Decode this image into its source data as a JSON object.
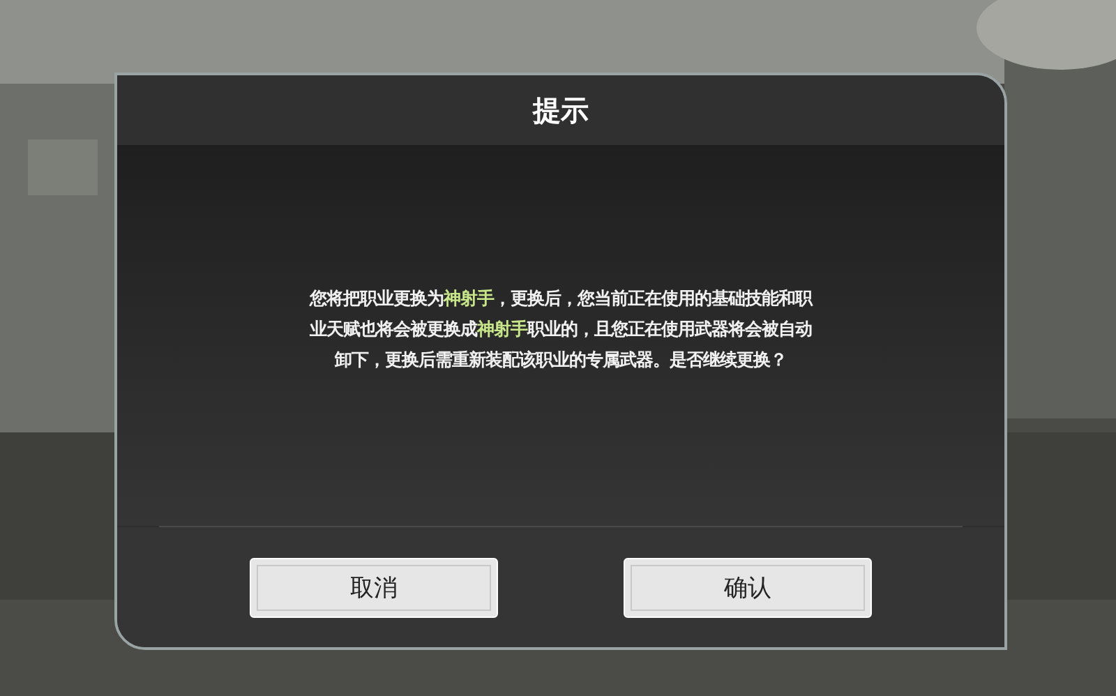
{
  "dialog": {
    "title": "提示",
    "message": "您将把职业更换为**神射手**，更换后，您当前正在使用的基础技能和职业天赋也将会被更换成**神射手**职业的，且您正在使用武器将会被自动卸下，更换后需重新装配该职业的专属武器。是否继续更换？",
    "buttons": [
      {
        "label": "取消"
      },
      {
        "label": "确认"
      }
    ]
  }
}
